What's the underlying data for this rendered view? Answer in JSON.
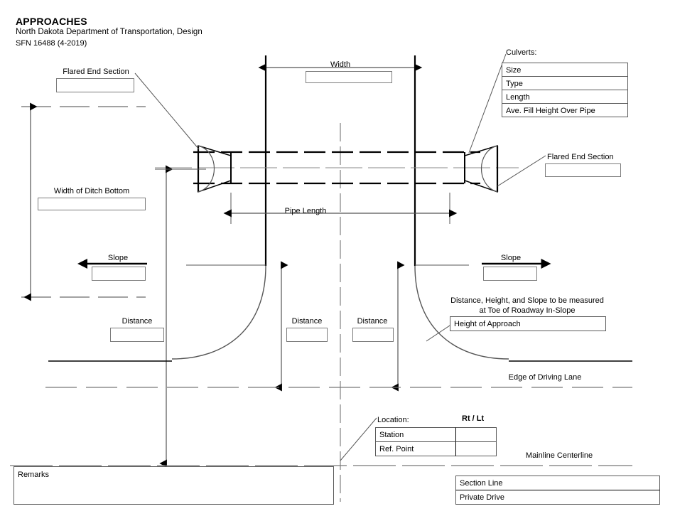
{
  "header": {
    "title": "APPROACHES",
    "agency": "North Dakota Department of Transportation, Design",
    "form_number": "SFN 16488 (4-2019)"
  },
  "culverts": {
    "heading": "Culverts:",
    "rows": [
      {
        "label": "Size",
        "value": ""
      },
      {
        "label": "Type",
        "value": ""
      },
      {
        "label": "Length",
        "value": ""
      },
      {
        "label": "Ave. Fill Height Over Pipe",
        "value": ""
      }
    ]
  },
  "labels": {
    "flared_end_section_left": "Flared End Section",
    "flared_end_section_right": "Flared End Section",
    "width_of_ditch_bottom": "Width of Ditch Bottom",
    "width": "Width",
    "pipe_length": "Pipe Length",
    "slope_left": "Slope",
    "slope_right": "Slope",
    "distance_left": "Distance",
    "distance_center_left": "Distance",
    "distance_center_right": "Distance",
    "edge_of_driving_lane": "Edge of Driving Lane",
    "mainline_centerline": "Mainline Centerline",
    "note_line1": "Distance, Height, and Slope to be measured",
    "note_line2": "at Toe of Roadway In-Slope"
  },
  "fields": {
    "flared_end_section_left": "",
    "flared_end_section_right": "",
    "width_of_ditch_bottom": "",
    "width": "",
    "slope_left": "",
    "slope_right": "",
    "distance_left": "",
    "distance_center_left": "",
    "distance_center_right": "",
    "height_of_approach_label": "Height of Approach",
    "height_of_approach_value": "",
    "remarks_label": "Remarks",
    "remarks_value": "",
    "section_line_label": "Section Line",
    "section_line_value": "",
    "private_drive_label": "Private Drive",
    "private_drive_value": ""
  },
  "location": {
    "heading": "Location:",
    "column_header": "Rt / Lt",
    "rows": [
      {
        "label": "Station",
        "value": ""
      },
      {
        "label": "Ref. Point",
        "value": ""
      }
    ]
  },
  "colors": {
    "ink": "#000000",
    "rule": "#555555",
    "field_border": "#7b7b7b",
    "paper": "#ffffff"
  }
}
